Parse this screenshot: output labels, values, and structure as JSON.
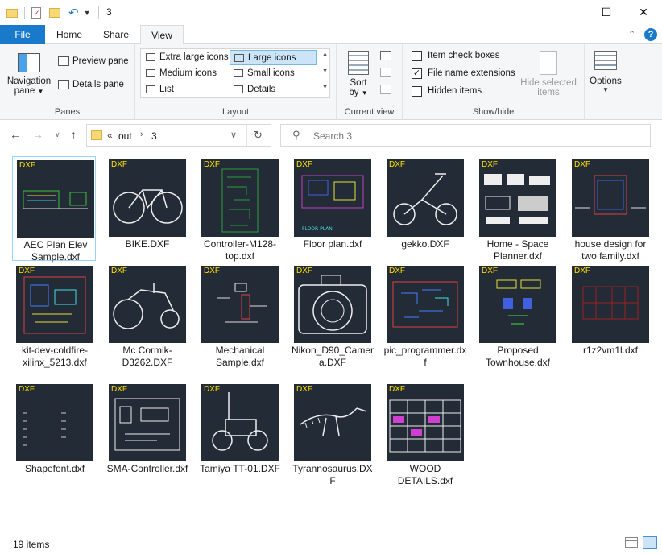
{
  "window": {
    "title": "3",
    "minimize": "—",
    "maximize": "☐",
    "close": "✕"
  },
  "ribbon_tabs": [
    {
      "label": "File"
    },
    {
      "label": "Home"
    },
    {
      "label": "Share"
    },
    {
      "label": "View"
    }
  ],
  "ribbon": {
    "panes": {
      "navigation_pane": "Navigation",
      "navigation_pane_2": "pane",
      "preview_pane": "Preview pane",
      "details_pane": "Details pane",
      "label": "Panes"
    },
    "layout": {
      "options": [
        "Extra large icons",
        "Large icons",
        "Medium icons",
        "Small icons",
        "List",
        "Details"
      ],
      "selected": "Large icons",
      "label": "Layout"
    },
    "current_view": {
      "sort_by": "Sort",
      "sort_by_2": "by",
      "label": "Current view"
    },
    "show_hide": {
      "item_check_boxes": "Item check boxes",
      "file_name_extensions": "File name extensions",
      "hidden_items": "Hidden items",
      "hide_selected": "Hide selected",
      "hide_selected_2": "items",
      "label": "Show/hide",
      "item_check_boxes_checked": false,
      "file_name_extensions_checked": true,
      "hidden_items_checked": false
    },
    "options": "Options"
  },
  "address": {
    "overflow": "«",
    "crumbs": [
      "out",
      "3"
    ]
  },
  "search": {
    "placeholder": "Search 3"
  },
  "files": [
    {
      "name": "AEC Plan Elev Sample.dxf",
      "badge": "DXF",
      "selected": true
    },
    {
      "name": "BIKE.DXF",
      "badge": "DXF"
    },
    {
      "name": "Controller-M128-top.dxf",
      "badge": "DXF"
    },
    {
      "name": "Floor plan.dxf",
      "badge": "DXF"
    },
    {
      "name": "gekko.DXF",
      "badge": "DXF"
    },
    {
      "name": "Home - Space Planner.dxf",
      "badge": "DXF"
    },
    {
      "name": "house design for two family.dxf",
      "badge": "DXF"
    },
    {
      "name": "kit-dev-coldfire-xilinx_5213.dxf",
      "badge": "DXF"
    },
    {
      "name": "Mc Cormik-D3262.DXF",
      "badge": "DXF"
    },
    {
      "name": "Mechanical Sample.dxf",
      "badge": "DXF"
    },
    {
      "name": "Nikon_D90_Camera.DXF",
      "badge": "DXF"
    },
    {
      "name": "pic_programmer.dxf",
      "badge": "DXF"
    },
    {
      "name": "Proposed Townhouse.dxf",
      "badge": "DXF"
    },
    {
      "name": "r1z2vm1l.dxf",
      "badge": "DXF"
    },
    {
      "name": "Shapefont.dxf",
      "badge": "DXF"
    },
    {
      "name": "SMA-Controller.dxf",
      "badge": "DXF"
    },
    {
      "name": "Tamiya TT-01.DXF",
      "badge": "DXF"
    },
    {
      "name": "Tyrannosaurus.DXF",
      "badge": "DXF"
    },
    {
      "name": "WOOD DETAILS.dxf",
      "badge": "DXF"
    }
  ],
  "floor_plan_caption": "FLOOR PLAN",
  "status": {
    "count": "19 items"
  },
  "colors": {
    "accent": "#1979ca",
    "thumb_bg": "#222b36",
    "badge": "#ffe000"
  }
}
